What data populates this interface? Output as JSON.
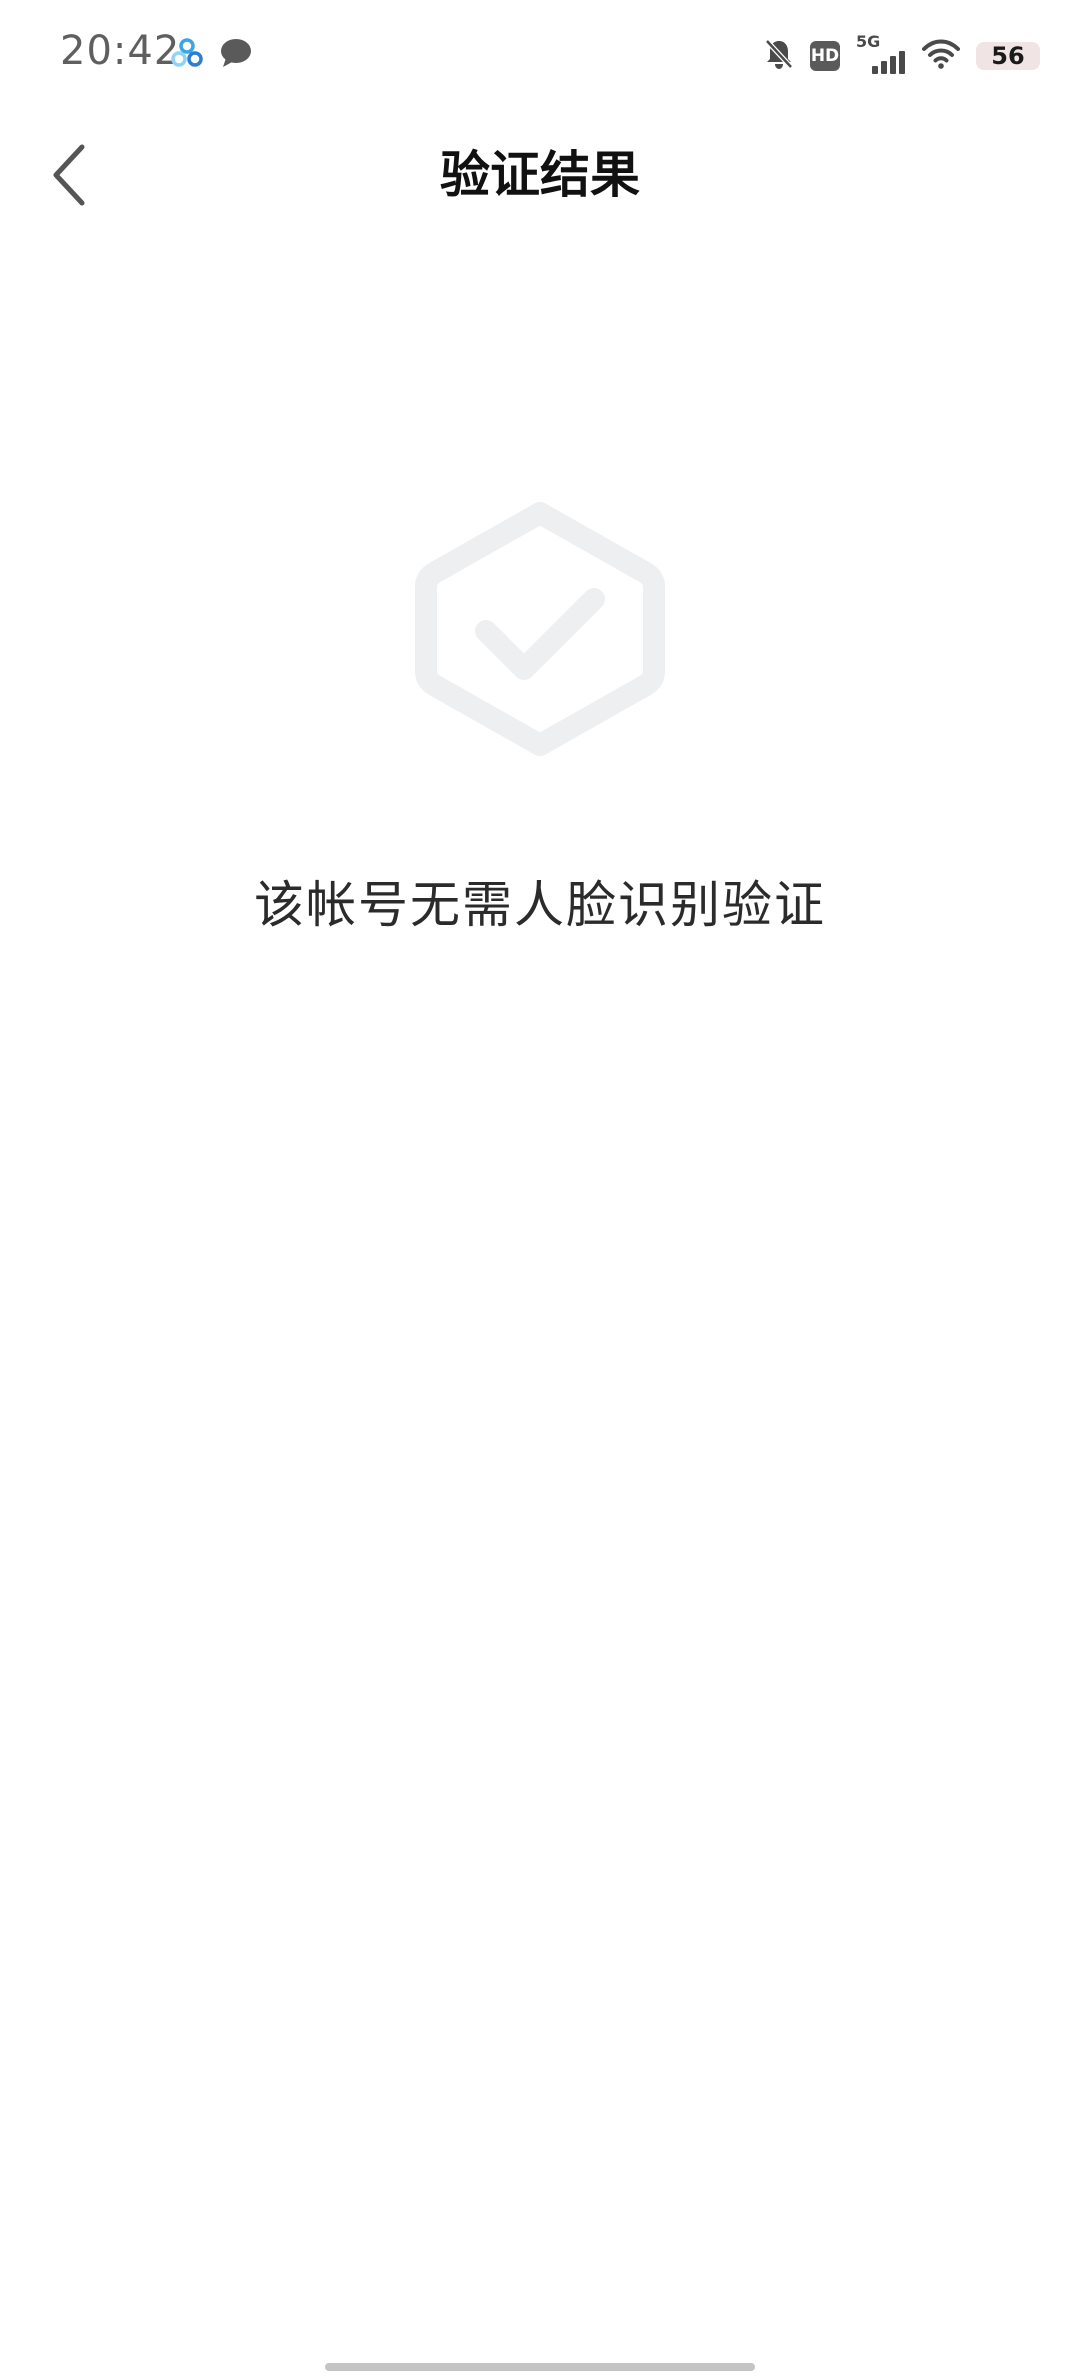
{
  "status_bar": {
    "time": "20:42",
    "network": "5G",
    "battery": "56",
    "icons": [
      "cloud-sync-icon",
      "chat-bubble-icon",
      "mute-bell-icon",
      "hd-icon",
      "signal-icon",
      "wifi-icon",
      "battery-icon"
    ],
    "hd_label": "HD"
  },
  "header": {
    "title": "验证结果",
    "back_icon": "chevron-left-icon"
  },
  "result": {
    "icon": "shield-check-icon",
    "message": "该帐号无需人脸识别验证",
    "icon_color": "#eeeff1"
  },
  "colors": {
    "background": "#ffffff",
    "title": "#111111",
    "message": "#2b2b2b",
    "home_indicator": "#c4c4c4"
  }
}
